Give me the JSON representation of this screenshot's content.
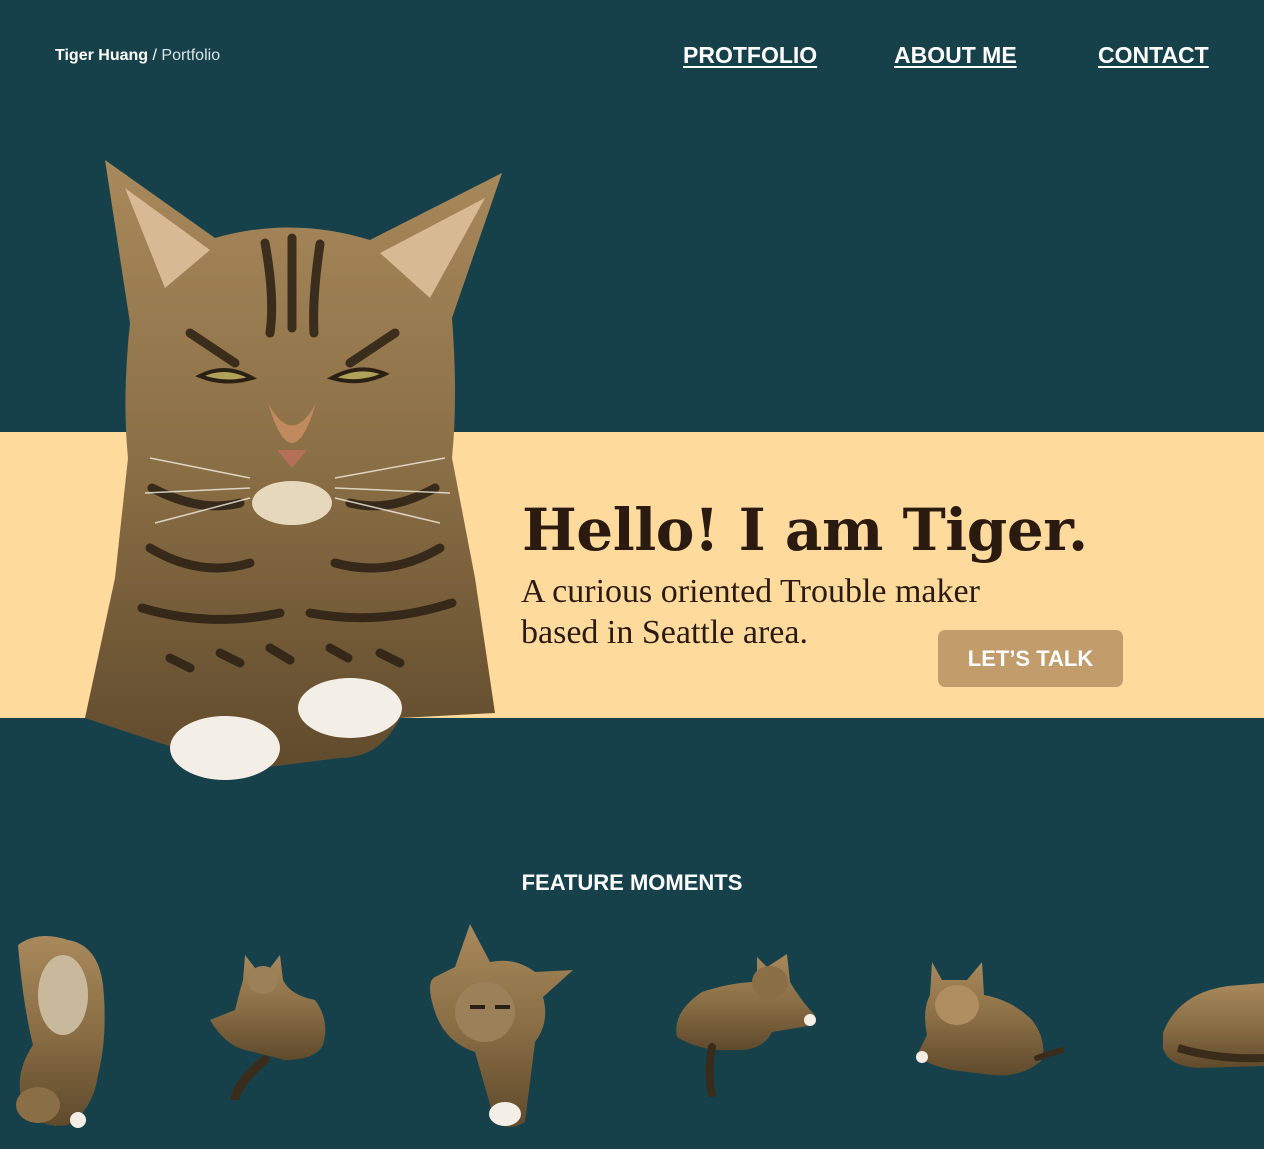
{
  "header": {
    "brand_name": "Tiger Huang",
    "brand_separator": " / ",
    "brand_sub": "Portfolio",
    "nav": [
      "PROTFOLIO",
      "ABOUT ME",
      "CONTACT"
    ]
  },
  "hero": {
    "headline": "Hello! I am Tiger.",
    "tagline": "A curious oriented Trouble maker based in Seattle area.",
    "cta_label": "LET’S TALK",
    "image": "tabby-cat-portrait"
  },
  "features": {
    "title": "FEATURE MOMENTS",
    "images": [
      "cat-upside-down",
      "cat-lying-tail-curl",
      "cat-face-closeup",
      "cat-lounging",
      "cat-lying-front",
      "cat-curled-sleeping"
    ]
  },
  "colors": {
    "background": "#16414b",
    "band": "#fedb9d",
    "button": "#c39c6c",
    "text_dark": "#2a1a10",
    "cat_fur": "#8c7148"
  }
}
